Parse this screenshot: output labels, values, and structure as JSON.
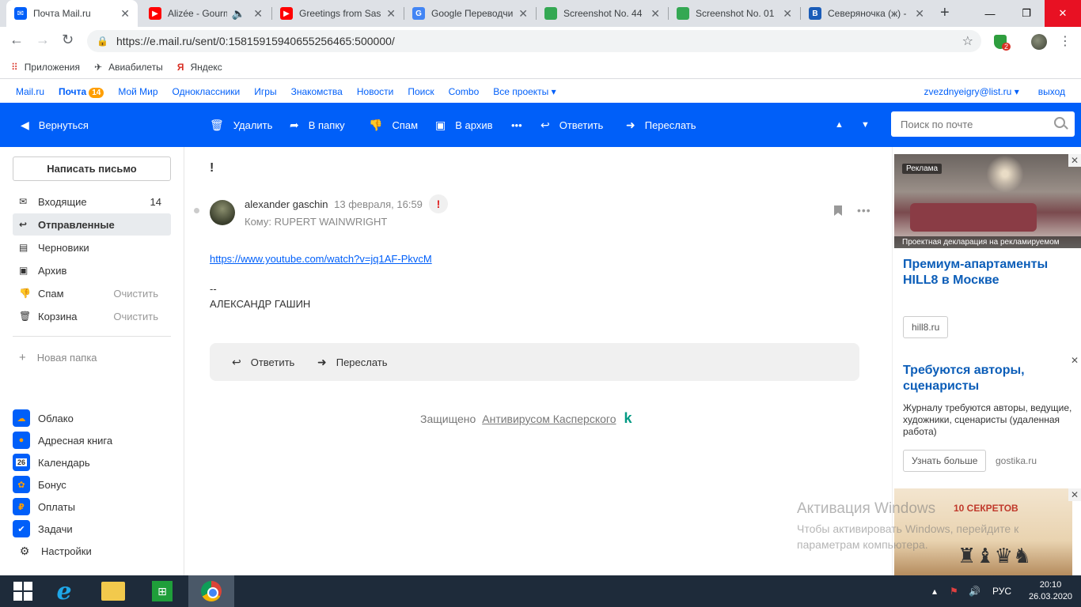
{
  "browser": {
    "tabs": [
      {
        "title": "Почта Mail.ru",
        "favicon": "mail-icon",
        "color": "#005ff9"
      },
      {
        "title": "Alizée - Gourm",
        "favicon": "youtube-icon",
        "color": "#ff0000"
      },
      {
        "title": "Greetings from Sas",
        "favicon": "youtube-icon",
        "color": "#ff0000"
      },
      {
        "title": "Google Переводчи",
        "favicon": "google-translate-icon",
        "color": "#4285f4"
      },
      {
        "title": "Screenshot No. 44",
        "favicon": "sheet-icon",
        "color": "#34a853"
      },
      {
        "title": "Screenshot No. 01",
        "favicon": "sheet-icon",
        "color": "#34a853"
      },
      {
        "title": "Северяночка (ж) -",
        "favicon": "b-icon",
        "color": "#1a5cb8"
      }
    ],
    "url": "https://e.mail.ru/sent/0:15815915940655256465:500000/",
    "extension_badge": "2",
    "bookmarks": [
      {
        "label": "Приложения",
        "icon": "apps-icon"
      },
      {
        "label": "Авиабилеты",
        "icon": "plane-icon"
      },
      {
        "label": "Яндекс",
        "icon": "yandex-icon"
      }
    ]
  },
  "portal": {
    "links": [
      "Mail.ru",
      "Почта",
      "Мой Мир",
      "Одноклассники",
      "Игры",
      "Знакомства",
      "Новости",
      "Поиск",
      "Combo",
      "Все проекты"
    ],
    "mail_badge": "14",
    "user": "zvezdnyeigry@list.ru",
    "logout": "выход"
  },
  "toolbar": {
    "back": "Вернуться",
    "delete": "Удалить",
    "to_folder": "В папку",
    "spam": "Спам",
    "archive": "В архив",
    "reply": "Ответить",
    "forward": "Переслать",
    "search_placeholder": "Поиск по почте"
  },
  "sidebar": {
    "compose": "Написать письмо",
    "folders": [
      {
        "label": "Входящие",
        "icon": "inbox-icon",
        "count": "14",
        "action": ""
      },
      {
        "label": "Отправленные",
        "icon": "sent-icon",
        "count": "",
        "action": ""
      },
      {
        "label": "Черновики",
        "icon": "draft-icon",
        "count": "",
        "action": ""
      },
      {
        "label": "Архив",
        "icon": "archive-icon",
        "count": "",
        "action": ""
      },
      {
        "label": "Спам",
        "icon": "spam-icon",
        "count": "",
        "action": "Очистить"
      },
      {
        "label": "Корзина",
        "icon": "trash-icon",
        "count": "",
        "action": "Очистить"
      }
    ],
    "new_folder": "Новая папка",
    "services": [
      {
        "label": "Облако",
        "icon": "cloud-icon"
      },
      {
        "label": "Адресная книга",
        "icon": "contacts-icon"
      },
      {
        "label": "Календарь",
        "icon": "calendar-icon",
        "glyph": "26"
      },
      {
        "label": "Бонус",
        "icon": "bonus-icon"
      },
      {
        "label": "Оплаты",
        "icon": "payments-icon"
      },
      {
        "label": "Задачи",
        "icon": "tasks-icon"
      },
      {
        "label": "Настройки",
        "icon": "gear-icon"
      }
    ]
  },
  "message": {
    "subject": "!",
    "sender": "alexander gaschin",
    "date": "13 февраля, 16:59",
    "to": "Кому: RUPERT WAINWRIGHT",
    "link": "https://www.youtube.com/watch?v=jq1AF-PkvcM",
    "sig_dash": "--",
    "sig_name": "АЛЕКСАНДР ГАШИН",
    "reply": "Ответить",
    "forward": "Переслать",
    "protected_by": "Защищено",
    "antivirus": "Антивирусом Касперского"
  },
  "ads": {
    "label": "Реклама",
    "caption": "Проектная декларация на рекламируемом",
    "title1": "Премиум-апартаменты HILL8 в Москве",
    "btn1": "hill8.ru",
    "title2": "Требуются авторы, сценаристы",
    "text2": "Журналу требуются авторы, ведущие, художники, сценаристы (удаленная работа)",
    "btn2": "Узнать больше",
    "domain2": "gostika.ru",
    "chess_title": "10 СЕКРЕТОВ"
  },
  "watermark": {
    "line1": "Активация Windows",
    "line2": "Чтобы активировать Windows, перейдите к параметрам компьютера."
  },
  "taskbar": {
    "lang": "РУС",
    "time": "20:10",
    "date": "26.03.2020"
  }
}
